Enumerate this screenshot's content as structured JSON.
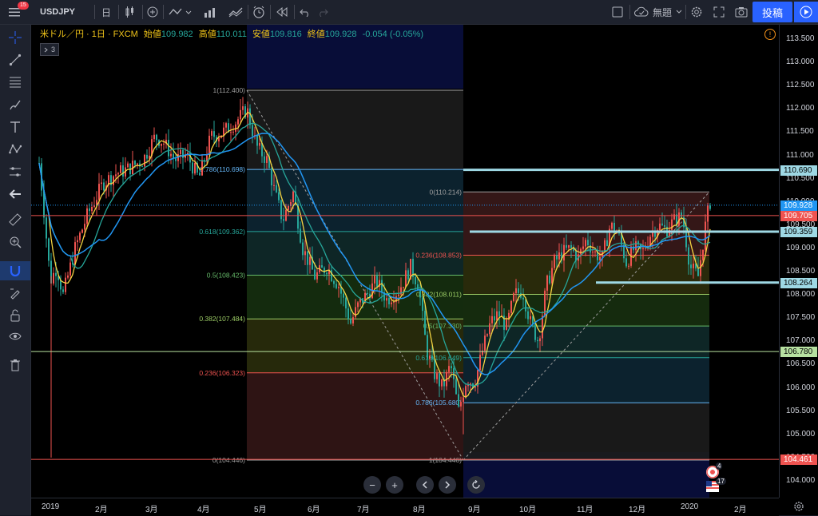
{
  "topbar": {
    "notification_count": "15",
    "symbol": "USDJPY",
    "interval": "日",
    "template_label": "無題",
    "publish_label": "投稿"
  },
  "legend": {
    "name": "米ドル／円 · 1日 · FXCM",
    "open_label": "始値",
    "open_value": "109.982",
    "high_label": "高値",
    "high_value": "110.011",
    "low_label": "安値",
    "low_value": "109.816",
    "close_label": "終値",
    "close_value": "109.928",
    "change": "-0.054 (-0.05%)",
    "collapsed_count": "3"
  },
  "price_axis": {
    "ticks": [
      "113.500",
      "113.000",
      "112.500",
      "112.000",
      "111.500",
      "111.000",
      "110.500",
      "110.000",
      "109.500",
      "109.000",
      "108.500",
      "108.000",
      "107.500",
      "107.000",
      "106.500",
      "106.000",
      "105.500",
      "105.000",
      "104.500",
      "104.000"
    ],
    "tags": [
      {
        "text": "110.690",
        "bg": "#9ed8e4",
        "fg": "#000000"
      },
      {
        "text": "109.928",
        "bg": "#2196f3",
        "fg": "#ffffff"
      },
      {
        "text": "109.705",
        "bg": "#ef5350",
        "fg": "#ffffff"
      },
      {
        "text": "109.359",
        "bg": "#9ed8e4",
        "fg": "#000000"
      },
      {
        "text": "108.264",
        "bg": "#9ed8e4",
        "fg": "#000000"
      },
      {
        "text": "106.780",
        "bg": "#b7e1a1",
        "fg": "#000000"
      },
      {
        "text": "104.461",
        "bg": "#ef5350",
        "fg": "#ffffff"
      }
    ]
  },
  "time_axis": {
    "ticks": [
      "2019",
      "2月",
      "3月",
      "4月",
      "5月",
      "6月",
      "7月",
      "8月",
      "9月",
      "10月",
      "11月",
      "12月",
      "2020",
      "2月"
    ]
  },
  "fib1": {
    "levels": [
      {
        "ratio": "1",
        "price": "112.400",
        "color": "#9e9e9e"
      },
      {
        "ratio": "0.786",
        "price": "110.698",
        "color": "#64b5f6"
      },
      {
        "ratio": "0.618",
        "price": "109.362",
        "color": "#26a69a"
      },
      {
        "ratio": "0.5",
        "price": "108.423",
        "color": "#66bb6a"
      },
      {
        "ratio": "0.382",
        "price": "107.484",
        "color": "#9ccc65"
      },
      {
        "ratio": "0.236",
        "price": "106.323",
        "color": "#ef5350"
      },
      {
        "ratio": "0",
        "price": "104.446",
        "color": "#9e9e9e"
      }
    ]
  },
  "fib2": {
    "levels": [
      {
        "ratio": "0",
        "price": "110.214",
        "color": "#9e9e9e"
      },
      {
        "ratio": "0.236",
        "price": "108.853",
        "color": "#ef5350"
      },
      {
        "ratio": "0.382",
        "price": "108.011",
        "color": "#9ccc65"
      },
      {
        "ratio": "0.5",
        "price": "107.330",
        "color": "#66bb6a"
      },
      {
        "ratio": "0.618",
        "price": "106.649",
        "color": "#26a69a"
      },
      {
        "ratio": "0.786",
        "price": "105.680",
        "color": "#64b5f6"
      },
      {
        "ratio": "1",
        "price": "104.446",
        "color": "#9e9e9e"
      }
    ]
  },
  "event_badges": {
    "earnings": "4",
    "dividends": "17"
  },
  "colors": {
    "up": "#ef5350",
    "down": "#26a69a",
    "ma_fast": "#f5d442",
    "ma_mid": "#26a69a",
    "ma_slow": "#2196f3",
    "hline": "#9ed8e4"
  }
}
